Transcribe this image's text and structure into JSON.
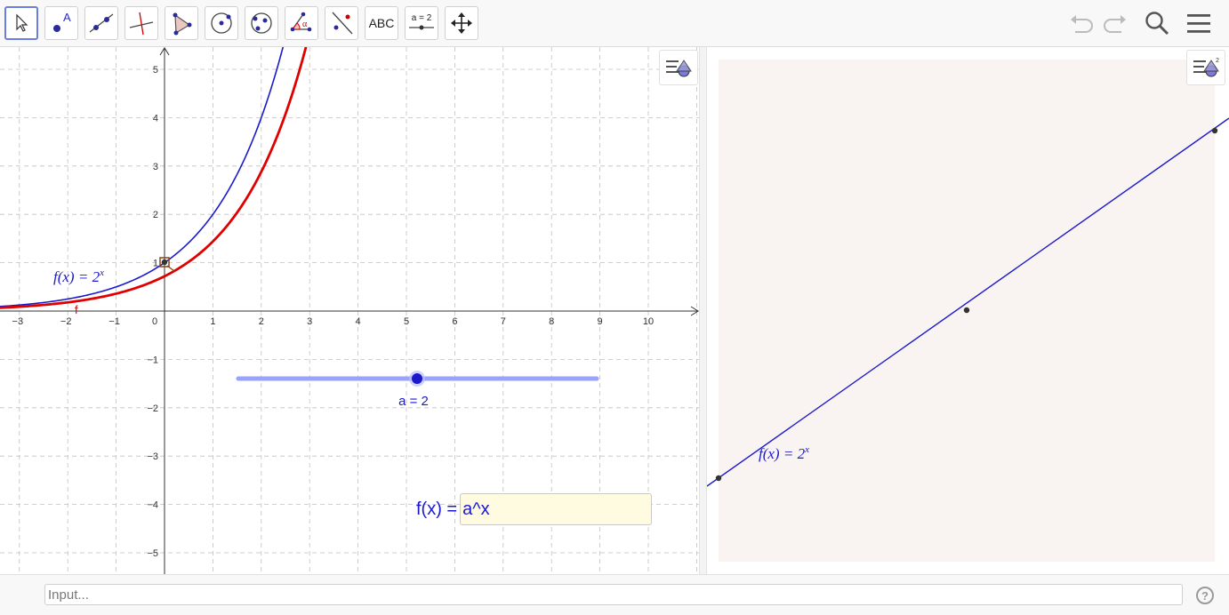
{
  "toolbar": {
    "tools": [
      {
        "name": "move-tool",
        "selected": true
      },
      {
        "name": "point-tool",
        "icon_text": "A"
      },
      {
        "name": "line-tool"
      },
      {
        "name": "perpendicular-line-tool"
      },
      {
        "name": "polygon-tool"
      },
      {
        "name": "circle-center-point-tool"
      },
      {
        "name": "circle-three-points-tool"
      },
      {
        "name": "angle-tool",
        "icon_text": "α"
      },
      {
        "name": "reflect-tool"
      },
      {
        "name": "text-tool",
        "label": "ABC"
      },
      {
        "name": "slider-tool",
        "label": "a = 2"
      },
      {
        "name": "move-graphics-view-tool"
      }
    ],
    "right_icons": [
      "undo-icon",
      "redo-icon",
      "search-icon",
      "menu-icon"
    ]
  },
  "graphics1": {
    "x_ticks": [
      "−3",
      "−2",
      "−1",
      "0",
      "1",
      "2",
      "3",
      "4",
      "5",
      "6",
      "7",
      "8",
      "9",
      "10"
    ],
    "y_ticks": [
      "5",
      "4",
      "3",
      "2",
      "1",
      "−1",
      "−2",
      "−3",
      "−4",
      "−5"
    ],
    "function_label_prefix": "f(x)  =  2",
    "function_label_exponent": "x",
    "red_curve_label": "f",
    "slider_label": "a = 2",
    "slider_value": 2,
    "input_label": "f(x) =",
    "input_value": "a^x",
    "colors": {
      "blue_curve": "#1a1acc",
      "red_curve": "#e00000",
      "slider": "#99a3ff",
      "grid": "#c0c0c0"
    }
  },
  "graphics2": {
    "function_label_prefix": "f(x)  =  2",
    "function_label_exponent": "x",
    "background": "#f9f4f2"
  },
  "algebra_input": {
    "placeholder": "Input..."
  },
  "help": {
    "label": "?"
  }
}
